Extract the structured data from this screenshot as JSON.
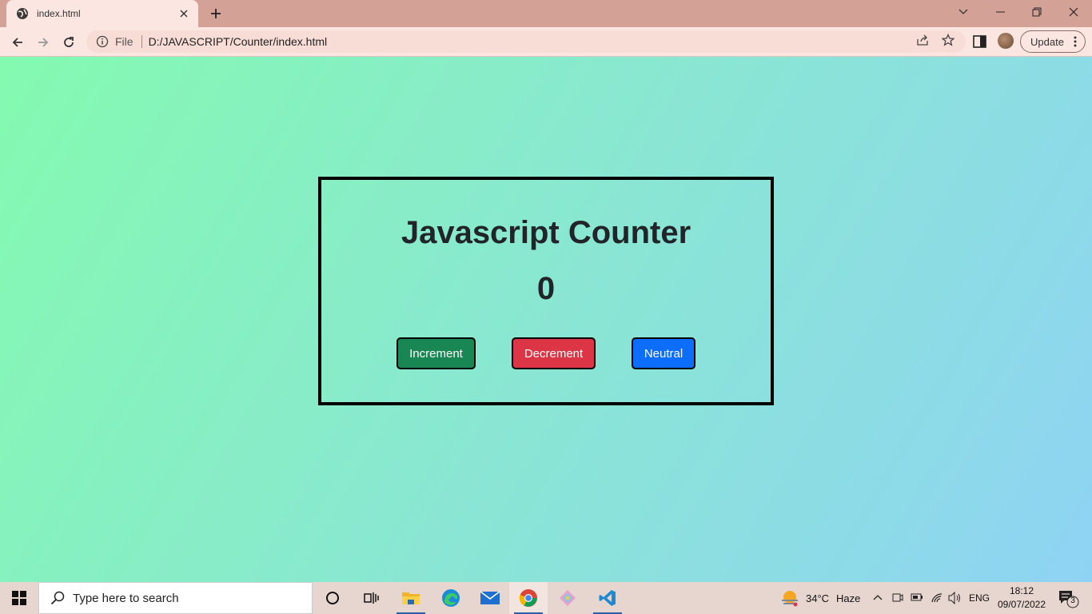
{
  "browser": {
    "tab_title": "index.html",
    "scheme_label": "File",
    "url": "D:/JAVASCRIPT/Counter/index.html",
    "update_label": "Update"
  },
  "app": {
    "title": "Javascript Counter",
    "count": "0",
    "buttons": {
      "increment": "Increment",
      "decrement": "Decrement",
      "neutral": "Neutral"
    },
    "colors": {
      "increment": "#198754",
      "decrement": "#dc3545",
      "neutral": "#0d6efd",
      "gradient_start": "#84fab0",
      "gradient_end": "#8fd3f4"
    }
  },
  "taskbar": {
    "search_placeholder": "Type here to search",
    "weather_temp": "34°C",
    "weather_desc": "Haze",
    "language": "ENG",
    "time": "18:12",
    "date": "09/07/2022",
    "notification_count": "3",
    "pinned_apps": [
      "cortana-icon",
      "task-view-icon",
      "file-explorer-icon",
      "edge-icon",
      "mail-icon",
      "chrome-icon",
      "git-icon",
      "vscode-icon"
    ]
  }
}
